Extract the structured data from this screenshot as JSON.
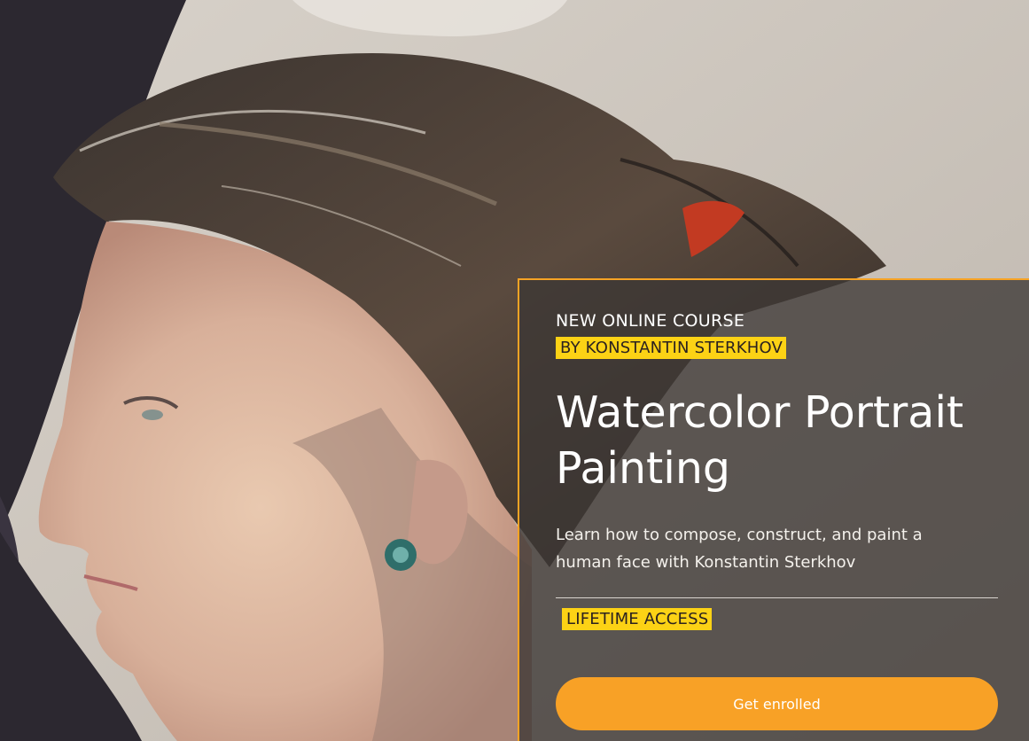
{
  "hero": {
    "background_image": "watercolor-portrait-painting",
    "card": {
      "eyebrow": "NEW ONLINE COURSE",
      "author_tag": "BY KONSTANTIN STERKHOV",
      "title": "Watercolor Portrait Painting",
      "description": "Learn how to compose, construct, and paint a human face with Konstantin Sterkhov",
      "access_tag": "LIFETIME ACCESS",
      "cta_label": "Get enrolled"
    }
  },
  "colors": {
    "accent": "#f8a126",
    "tag_yellow": "#fcd215",
    "card_bg": "rgba(60,55,52,0.78)"
  }
}
